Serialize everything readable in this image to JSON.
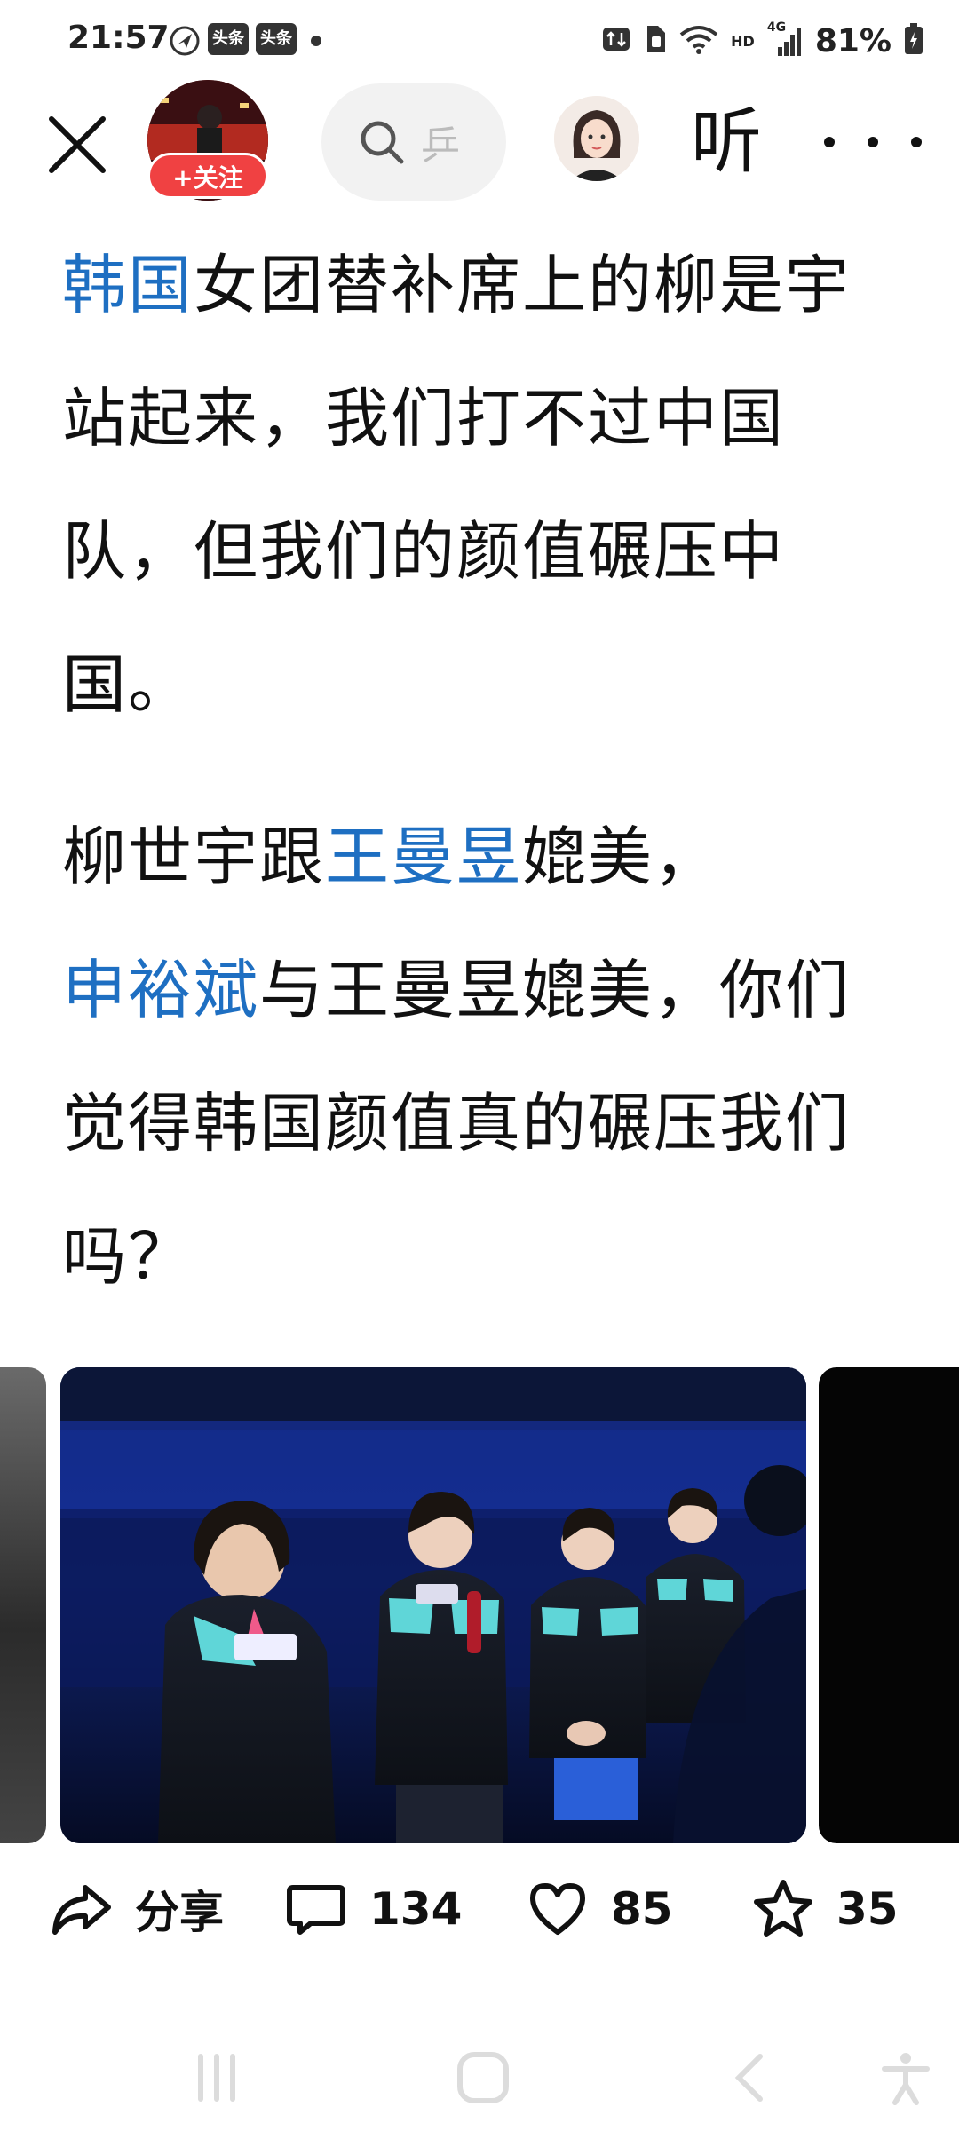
{
  "status_bar": {
    "time": "21:57",
    "app_badges": [
      "头条",
      "头条"
    ],
    "hd_label": "HD",
    "network_label": "4G",
    "battery": "81%",
    "icons": [
      "location-icon",
      "dot-icon",
      "data-transfer-icon",
      "sim-icon",
      "wifi-icon",
      "signal-icon",
      "battery-icon"
    ]
  },
  "header": {
    "follow_label": "+关注",
    "search_placeholder": "乒",
    "listen_label": "听"
  },
  "article": {
    "paragraph1": [
      {
        "text": "韩国",
        "link": true
      },
      {
        "text": "女团替补席上的柳是宇站起来，我们打不过中国队，但我们的颜值碾压中国。",
        "link": false
      }
    ],
    "paragraph2": [
      {
        "text": "柳世宇跟",
        "link": false
      },
      {
        "text": "王曼昱",
        "link": true
      },
      {
        "text": "媲美，",
        "link": false
      },
      {
        "text": "申裕斌",
        "link": true
      },
      {
        "text": "与王曼昱媲美，你们觉得韩国颜值真的碾压我们吗？",
        "link": false
      }
    ]
  },
  "actions": {
    "share_label": "分享",
    "comment_count": "134",
    "like_count": "85",
    "favorite_count": "35"
  },
  "colors": {
    "link": "#1e6fc2",
    "follow_bg": "#f04142",
    "search_bg": "#f2f2f2"
  }
}
